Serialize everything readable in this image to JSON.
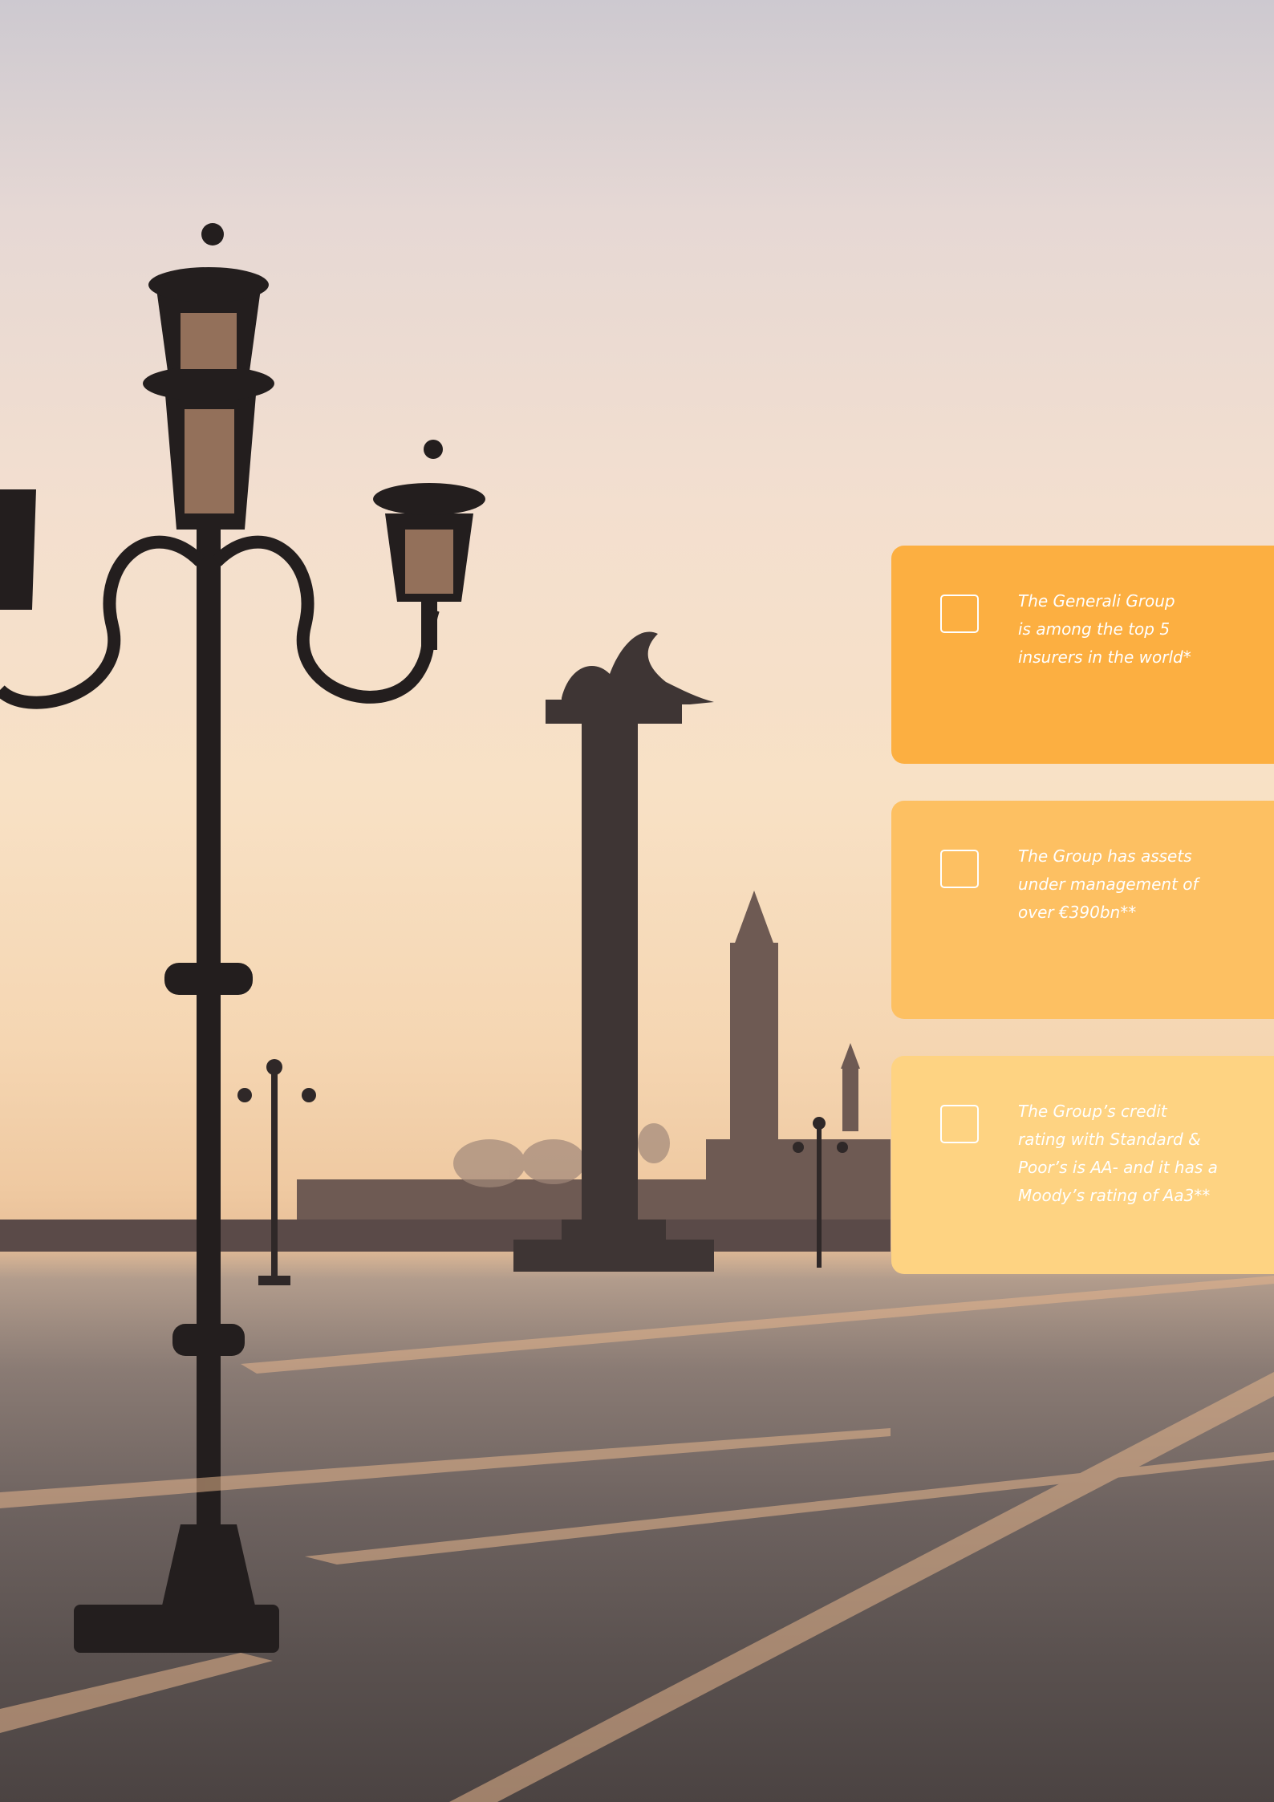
{
  "cards": [
    {
      "lines": [
        "The Generali Group",
        "is among the top 5",
        "insurers in the world*"
      ]
    },
    {
      "lines": [
        "The Group has assets",
        "under management of",
        "over €390bn**"
      ]
    },
    {
      "lines": [
        "The Group’s credit",
        "rating with Standard &",
        "Poor’s is AA- and it has a",
        "Moody’s rating of Aa3**"
      ]
    }
  ],
  "colors": {
    "card_1": "#fcaf41",
    "card_2": "#fdc062",
    "card_3": "#fed382",
    "text": "#ffffff"
  }
}
